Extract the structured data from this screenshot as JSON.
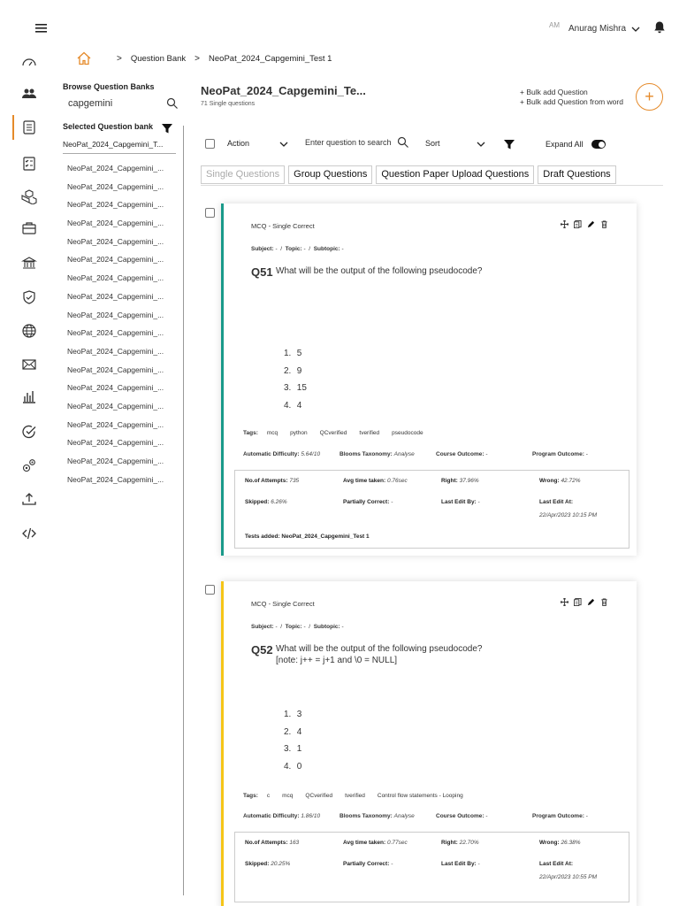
{
  "header": {
    "user_initials": "AM",
    "user_name": "Anurag Mishra"
  },
  "breadcrumb": {
    "items": [
      "Question Bank",
      "NeoPat_2024_Capgemini_Test 1"
    ]
  },
  "bank_sidebar": {
    "browse_label": "Browse Question Banks",
    "search_value": "capgemini",
    "selected_label": "Selected Question bank",
    "selected_value": "NeoPat_2024_Capgemini_T...",
    "items": [
      "NeoPat_2024_Capgemini_...",
      "NeoPat_2024_Capgemini_...",
      "NeoPat_2024_Capgemini_...",
      "NeoPat_2024_Capgemini_...",
      "NeoPat_2024_Capgemini_...",
      "NeoPat_2024_Capgemini_...",
      "NeoPat_2024_Capgemini_...",
      "NeoPat_2024_Capgemini_...",
      "NeoPat_2024_Capgemini_...",
      "NeoPat_2024_Capgemini_...",
      "NeoPat_2024_Capgemini_...",
      "NeoPat_2024_Capgemini_...",
      "NeoPat_2024_Capgemini_...",
      "NeoPat_2024_Capgemini_...",
      "NeoPat_2024_Capgemini_...",
      "NeoPat_2024_Capgemini_...",
      "NeoPat_2024_Capgemini_...",
      "NeoPat_2024_Capgemini_..."
    ]
  },
  "main": {
    "title": "NeoPat_2024_Capgemini_Te...",
    "subtitle": "71 Single questions",
    "bulk_add": "+ Bulk add Question",
    "bulk_add_word": "+ Bulk add Question from word",
    "add_button": "+"
  },
  "toolbar": {
    "action_label": "Action",
    "search_placeholder": "Enter question to search",
    "sort_label": "Sort",
    "expand_all": "Expand All"
  },
  "tabs": [
    "Single Questions",
    "Group Questions",
    "Question Paper Upload Questions",
    "Draft Questions"
  ],
  "questions": [
    {
      "type": "MCQ - Single Correct",
      "subject_label": "Subject:",
      "subject": "-",
      "topic_label": "Topic:",
      "topic": "-",
      "subtopic_label": "Subtopic:",
      "subtopic": "-",
      "number": "Q51",
      "text": "What will be the output of the following pseudocode?",
      "options": [
        "5",
        "9",
        "15",
        "4"
      ],
      "tags_label": "Tags:",
      "tags": [
        "mcq",
        "python",
        "QCverified",
        "tverified",
        "pseudocode"
      ],
      "auto_difficulty_label": "Automatic Difficulty:",
      "auto_difficulty": "5.64/10",
      "blooms_label": "Blooms Taxonomy:",
      "blooms": "Analyse",
      "course_outcome_label": "Course Outcome:",
      "course_outcome": "-",
      "program_outcome_label": "Program Outcome:",
      "program_outcome": "-",
      "stats": {
        "attempts_label": "No.of Attempts:",
        "attempts": "735",
        "avg_time_label": "Avg time taken:",
        "avg_time": "0.76sec",
        "right_label": "Right:",
        "right": "37.96%",
        "wrong_label": "Wrong:",
        "wrong": "42.72%",
        "skipped_label": "Skipped:",
        "skipped": "6.26%",
        "partial_label": "Partially Correct:",
        "partial": "-",
        "last_edit_by_label": "Last Edit By:",
        "last_edit_by": "-",
        "last_edit_at_label": "Last Edit At:",
        "last_edit_at": "22/Apr/2023 10:15 PM",
        "tests_added": "Tests added: NeoPat_2024_Capgemini_Test 1"
      }
    },
    {
      "type": "MCQ - Single Correct",
      "subject_label": "Subject:",
      "subject": "-",
      "topic_label": "Topic:",
      "topic": "-",
      "subtopic_label": "Subtopic:",
      "subtopic": "-",
      "number": "Q52",
      "text": "What will be the output of the following pseudocode?",
      "text2": "[note: j++ = j+1 and \\0 = NULL]",
      "options": [
        "3",
        "4",
        "1",
        "0"
      ],
      "tags_label": "Tags:",
      "tags": [
        "c",
        "mcq",
        "QCverified",
        "tverified",
        "Control flow statements - Looping"
      ],
      "auto_difficulty_label": "Automatic Difficulty:",
      "auto_difficulty": "1.86/10",
      "blooms_label": "Blooms Taxonomy:",
      "blooms": "Analyse",
      "course_outcome_label": "Course Outcome:",
      "course_outcome": "-",
      "program_outcome_label": "Program Outcome:",
      "program_outcome": "-",
      "stats": {
        "attempts_label": "No.of Attempts:",
        "attempts": "163",
        "avg_time_label": "Avg time taken:",
        "avg_time": "0.77sec",
        "right_label": "Right:",
        "right": "22.70%",
        "wrong_label": "Wrong:",
        "wrong": "26.38%",
        "skipped_label": "Skipped:",
        "skipped": "20.25%",
        "partial_label": "Partially Correct:",
        "partial": "-",
        "last_edit_by_label": "Last Edit By:",
        "last_edit_by": "-",
        "last_edit_at_label": "Last Edit At:",
        "last_edit_at": "22/Apr/2023 10:55 PM"
      }
    }
  ],
  "colors": {
    "accent": "#e58a2a",
    "card1_border": "#1a9a8a",
    "card2_border": "#f5c518"
  }
}
